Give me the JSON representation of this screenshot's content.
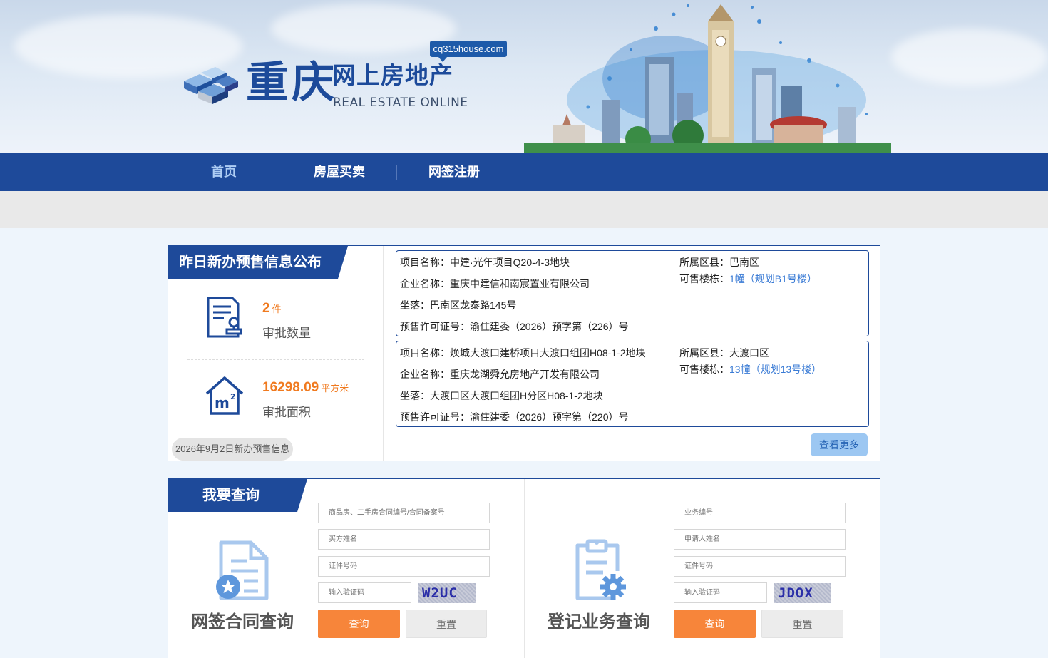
{
  "header": {
    "logo_chars": "重庆",
    "logo_cn": "网上房地产",
    "logo_en": "REAL ESTATE ONLINE",
    "domain": "cq315house.com"
  },
  "nav": {
    "items": [
      {
        "label": "首页",
        "active": true
      },
      {
        "label": "房屋买卖",
        "active": false
      },
      {
        "label": "网签注册",
        "active": false
      }
    ]
  },
  "presale": {
    "title": "昨日新办预售信息公布",
    "approvals": {
      "value": "2",
      "unit": "件",
      "label": "审批数量"
    },
    "area": {
      "value": "16298.09",
      "unit": "平方米",
      "label": "审批面积"
    },
    "date_note": "2026年9月2日新办预售信息",
    "more_label": "查看更多",
    "projects": [
      {
        "name": "项目名称：中建·光年项目Q20-4-3地块",
        "company": "企业名称：重庆中建信和南宸置业有限公司",
        "location": "坐落：巴南区龙泰路145号",
        "permit": "预售许可证号：渝住建委（2026）预字第（226）号",
        "district": "所属区县：巴南区",
        "buildings_label": "可售楼栋：",
        "buildings_value": "1幢（规划B1号楼）"
      },
      {
        "name": "项目名称：焕城大渡口建桥项目大渡口组团H08-1-2地块",
        "company": "企业名称：重庆龙湖舜允房地产开发有限公司",
        "location": "坐落：大渡口区大渡口组团H分区H08-1-2地块",
        "permit": "预售许可证号：渝住建委（2026）预字第（220）号",
        "district": "所属区县：大渡口区",
        "buildings_label": "可售楼栋：",
        "buildings_value": "13幢（规划13号楼）"
      }
    ]
  },
  "query": {
    "title": "我要查询",
    "contract": {
      "heading": "网签合同查询",
      "contract_no_placeholder": "商品房、二手房合同编号/合同备案号",
      "buyer_placeholder": "买方姓名",
      "id_placeholder": "证件号码",
      "captcha_placeholder": "输入验证码",
      "captcha_text": "W2UC",
      "submit_label": "查询",
      "reset_label": "重置"
    },
    "registration": {
      "heading": "登记业务查询",
      "business_no_placeholder": "业务编号",
      "applicant_placeholder": "申请人姓名",
      "id_placeholder": "证件号码",
      "captcha_placeholder": "输入验证码",
      "captcha_text": "JDOX",
      "submit_label": "查询",
      "reset_label": "重置"
    }
  },
  "colors": {
    "brand_blue": "#1e4a9a",
    "accent_orange": "#f07a1f",
    "link_blue": "#3a7bd5",
    "button_orange": "#f7853a"
  }
}
